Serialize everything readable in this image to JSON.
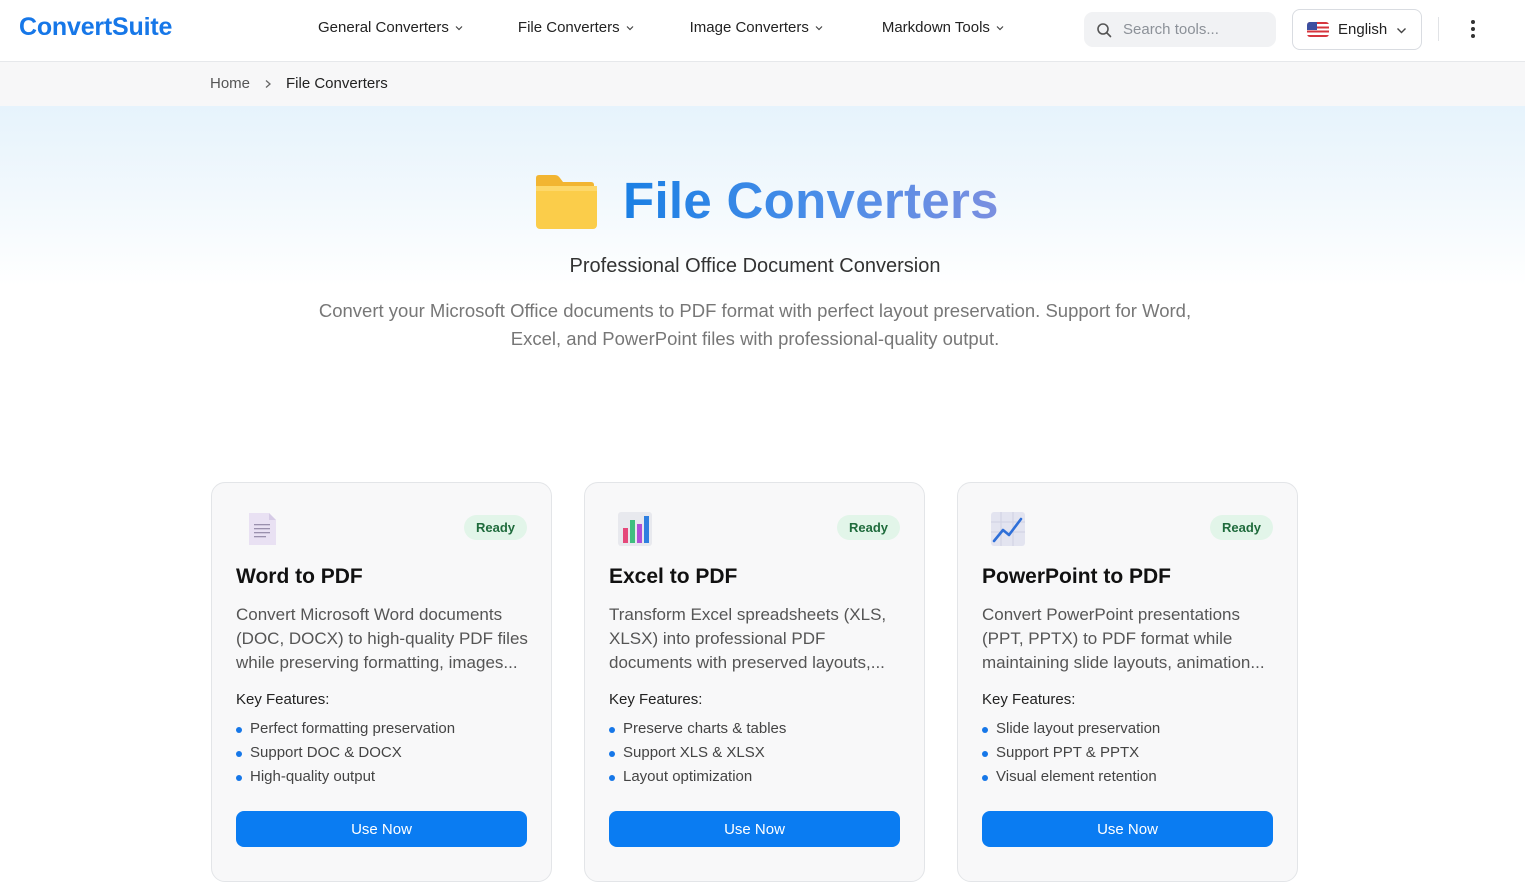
{
  "header": {
    "logo": "ConvertSuite",
    "nav": [
      {
        "label": "General Converters"
      },
      {
        "label": "File Converters"
      },
      {
        "label": "Image Converters"
      },
      {
        "label": "Markdown Tools"
      }
    ],
    "search": {
      "placeholder": "Search tools...",
      "value": ""
    },
    "language": {
      "label": "English",
      "icon": "us-flag-icon"
    }
  },
  "breadcrumb": {
    "home": "Home",
    "current": "File Converters"
  },
  "hero": {
    "title": "File Converters",
    "icon": "folder-icon",
    "subtitle": "Professional Office Document Conversion",
    "description": "Convert your Microsoft Office documents to PDF format with perfect layout preservation. Support for Word, Excel, and PowerPoint files with professional-quality output."
  },
  "cards": [
    {
      "icon": "document-icon",
      "badge": "Ready",
      "title": "Word to PDF",
      "description": "Convert Microsoft Word documents (DOC, DOCX) to high-quality PDF files while preserving formatting, images...",
      "features_label": "Key Features:",
      "features": [
        "Perfect formatting preservation",
        "Support DOC & DOCX",
        "High-quality output"
      ],
      "button": "Use Now"
    },
    {
      "icon": "bar-chart-icon",
      "badge": "Ready",
      "title": "Excel to PDF",
      "description": "Transform Excel spreadsheets (XLS, XLSX) into professional PDF documents with preserved layouts,...",
      "features_label": "Key Features:",
      "features": [
        "Preserve charts & tables",
        "Support XLS & XLSX",
        "Layout optimization"
      ],
      "button": "Use Now"
    },
    {
      "icon": "trend-chart-icon",
      "badge": "Ready",
      "title": "PowerPoint to PDF",
      "description": "Convert PowerPoint presentations (PPT, PPTX) to PDF format while maintaining slide layouts, animation...",
      "features_label": "Key Features:",
      "features": [
        "Slide layout preservation",
        "Support PPT & PPTX",
        "Visual element retention"
      ],
      "button": "Use Now"
    }
  ],
  "colors": {
    "brand": "#1677e8",
    "button": "#0a7cf2",
    "badge_bg": "#e2f5e9",
    "badge_text": "#1f6b3c"
  }
}
